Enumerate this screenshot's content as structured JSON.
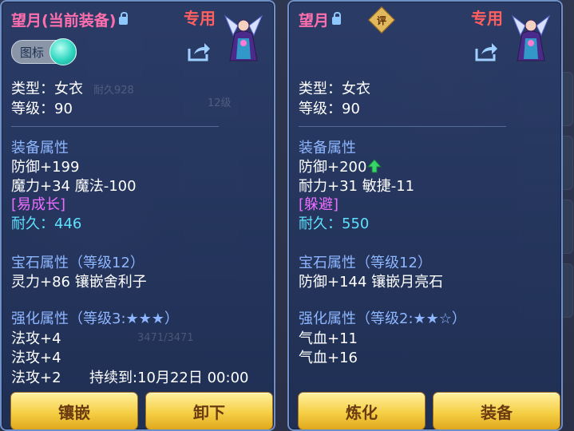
{
  "left": {
    "title": "望月",
    "status": "(当前装备)",
    "exclusive": "专用",
    "toggle_label": "图标",
    "type_line": "类型：女衣",
    "level_line": "等级：90",
    "section_equip": "装备属性",
    "attr1": "防御+199",
    "attr2": "魔力+34 魔法-100",
    "special": "[易成长]",
    "durability_label": "耐久：",
    "durability_value": "446",
    "section_gem": "宝石属性（等级12）",
    "gem_attr": "灵力+86 镶嵌舍利子",
    "section_enhance": "强化属性（等级3:★★★）",
    "enh1": "法攻+4",
    "enh2": "法攻+4",
    "enh3": "法攻+2",
    "duration": "持续到:10月22日 00:00",
    "btn_primary": "镶嵌",
    "btn_secondary": "卸下"
  },
  "right": {
    "title": "望月",
    "exclusive": "专用",
    "eval_badge": "评",
    "type_line": "类型：女衣",
    "level_line": "等级：90",
    "section_equip": "装备属性",
    "attr1": "防御+200",
    "attr2": "耐力+31 敏捷-11",
    "special": "[躲避]",
    "durability_label": "耐久：",
    "durability_value": "550",
    "section_gem": "宝石属性（等级12）",
    "gem_attr": "防御+144 镶嵌月亮石",
    "section_enhance": "强化属性（等级2:★★☆）",
    "enh1": "气血+11",
    "enh2": "气血+16",
    "btn_primary": "炼化",
    "btn_secondary": "装备"
  },
  "background": {
    "durability_hint": "耐久928",
    "level_hint": "12级",
    "progress_text": "3471/3471"
  },
  "colors": {
    "title": "#ff6fae",
    "section": "#8eb6ff",
    "special": "#ee6cff",
    "durability": "#5fe0ff",
    "button": "#f5cf45",
    "up_arrow": "#36d46a"
  },
  "icons": [
    "lock-icon",
    "share-icon",
    "character-avatar",
    "up-arrow-icon",
    "toggle-knob"
  ]
}
